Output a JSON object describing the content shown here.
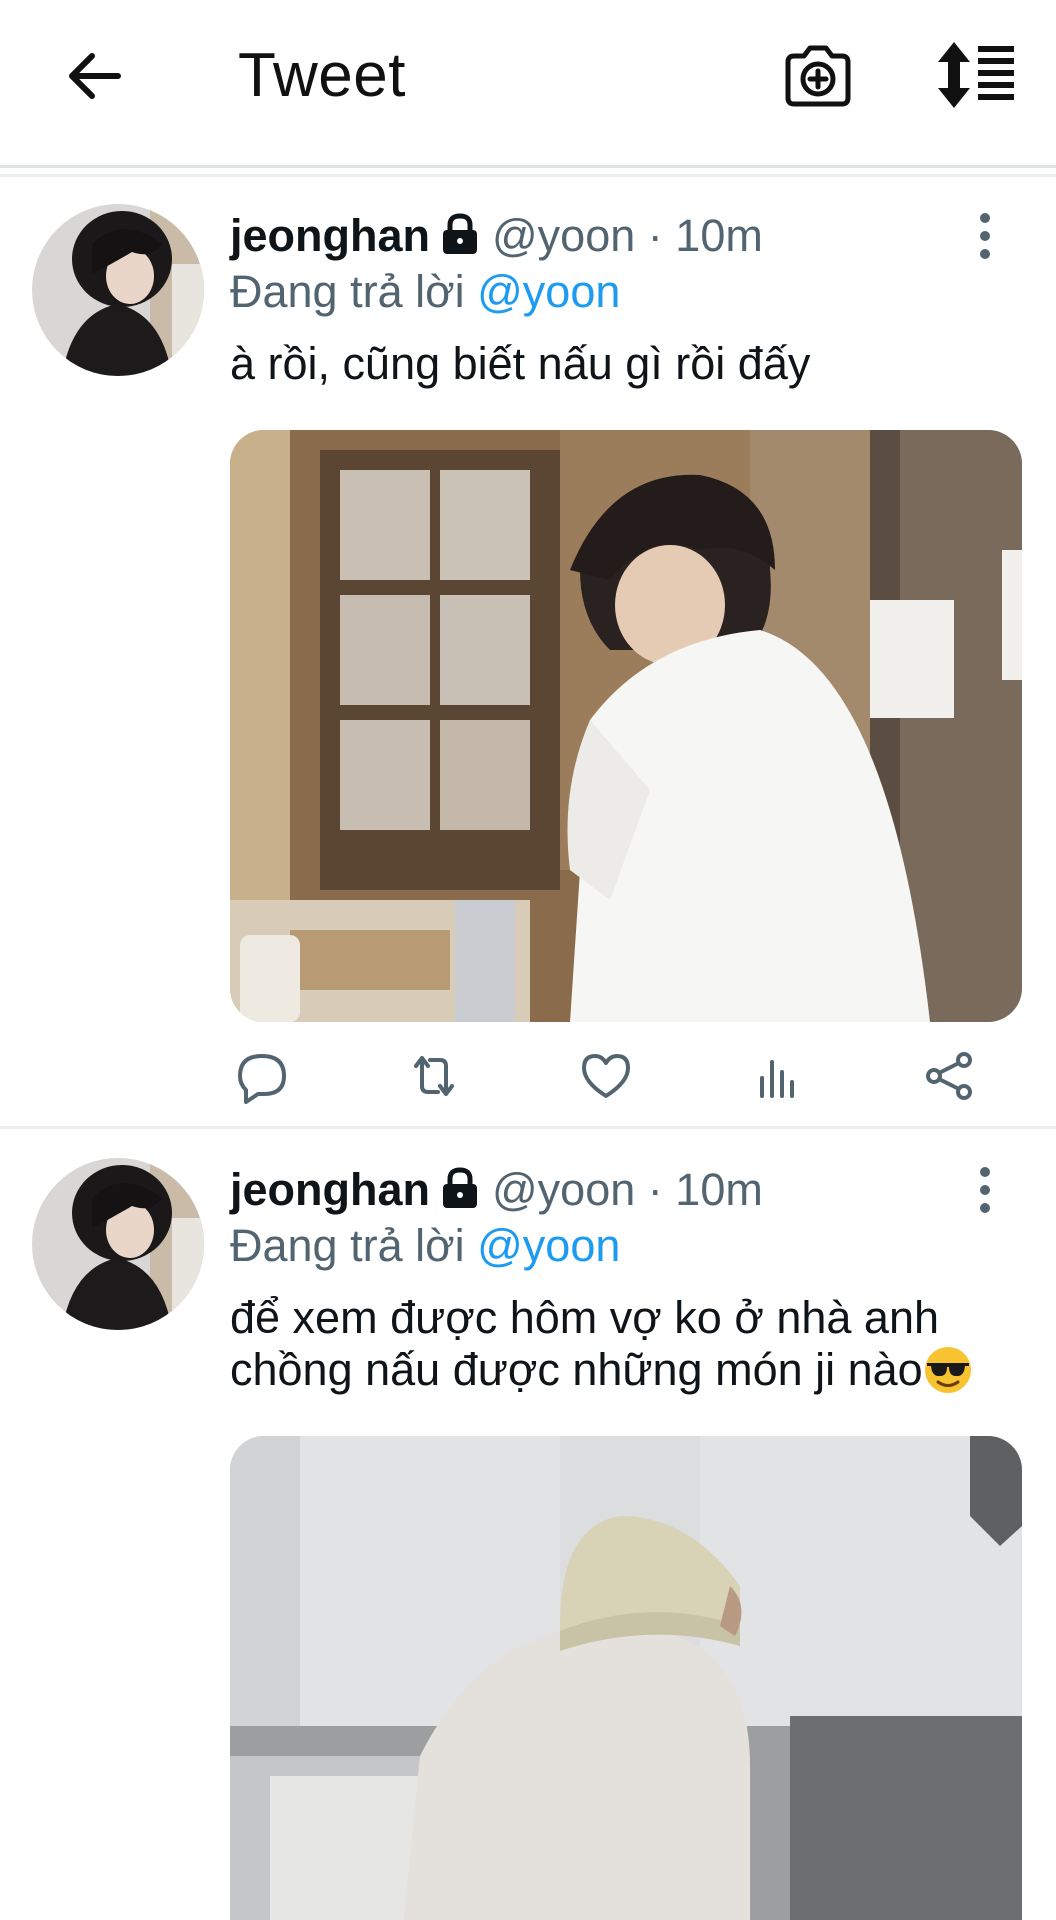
{
  "header": {
    "title": "Tweet",
    "back_icon": "arrow-left-icon",
    "camera_icon": "camera-plus-icon",
    "sort_icon": "sort-list-icon"
  },
  "tweets": [
    {
      "display_name": "jeonghan",
      "handle": "@yoon",
      "separator": "·",
      "time": "10m",
      "reply_prefix": "Đang trả lời",
      "reply_to": "@yoon",
      "text": "à rồi, cũng biết nấu gì rồi đấy",
      "text_line2": "",
      "has_emoji": false
    },
    {
      "display_name": "jeonghan",
      "handle": "@yoon",
      "separator": "·",
      "time": "10m",
      "reply_prefix": "Đang trả lời",
      "reply_to": "@yoon",
      "text": "để xem được hôm vợ ko ở nhà anh",
      "text_line2": "chồng nấu được những món ji nào",
      "has_emoji": true,
      "emoji": "😎"
    }
  ],
  "colors": {
    "accent": "#1d9bf0",
    "muted": "#536471",
    "divider": "#eceef0"
  }
}
